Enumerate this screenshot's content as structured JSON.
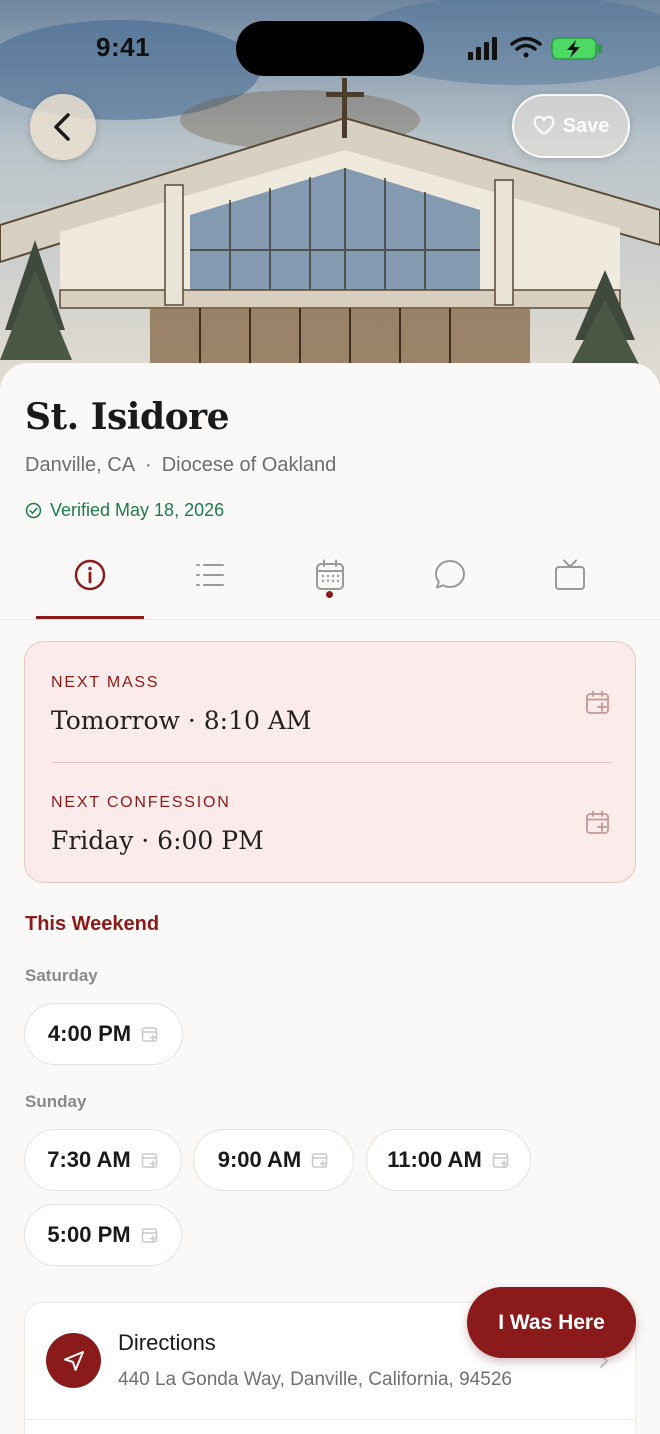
{
  "status_bar": {
    "time": "9:41"
  },
  "header": {
    "save_label": "Save"
  },
  "church": {
    "name": "St. Isidore",
    "location": "Danville, CA",
    "separator": "·",
    "diocese": "Diocese of Oakland",
    "verified": "Verified May 18, 2026"
  },
  "tabs": [
    {
      "icon": "info-icon",
      "selected": true
    },
    {
      "icon": "list-icon"
    },
    {
      "icon": "calendar-icon",
      "badge": true
    },
    {
      "icon": "chat-icon"
    },
    {
      "icon": "tv-icon"
    }
  ],
  "next": {
    "mass_label": "NEXT MASS",
    "mass_value": "Tomorrow · 8:10 AM",
    "confession_label": "NEXT CONFESSION",
    "confession_value": "Friday · 6:00 PM"
  },
  "weekend": {
    "title": "This Weekend",
    "saturday_label": "Saturday",
    "saturday_times": [
      "4:00 PM"
    ],
    "sunday_label": "Sunday",
    "sunday_times": [
      "7:30 AM",
      "9:00 AM",
      "11:00 AM",
      "5:00 PM"
    ]
  },
  "directions": {
    "title": "Directions",
    "address": "440 La Gonda Way, Danville, California, 94526"
  },
  "fab_label": "I Was Here",
  "colors": {
    "accent": "#8b1a1a",
    "verified": "#1f7a4d",
    "card_bg": "#fbeceb"
  }
}
